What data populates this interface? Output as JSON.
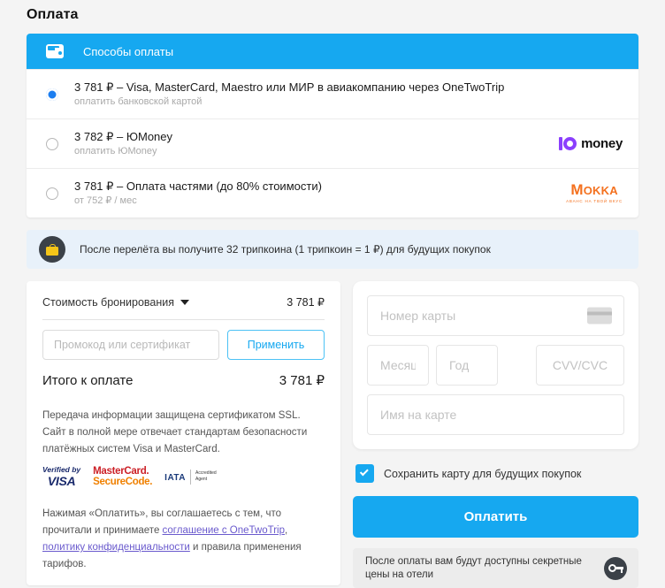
{
  "page": {
    "title": "Оплата"
  },
  "methods": {
    "header_title": "Способы оплаты",
    "header_icon": "wallet-icon",
    "options": [
      {
        "title": "3 781 ₽ – Visa, MasterCard, Maestro или МИР в авиакомпанию через OneTwoTrip",
        "subtitle": "оплатить банковской картой",
        "selected": true,
        "logo": null
      },
      {
        "title": "3 782 ₽ – ЮMoney",
        "subtitle": "оплатить ЮMoney",
        "selected": false,
        "logo": {
          "type": "yoomoney",
          "word": "money"
        }
      },
      {
        "title": "3 781 ₽ – Оплата частями (до 80% стоимости)",
        "subtitle": "от 752 ₽ / мес",
        "selected": false,
        "logo": {
          "type": "mokka",
          "word": "Mokka",
          "tagline": "АВАНС НА ТВОЙ ВКУС"
        }
      }
    ]
  },
  "tripcoin": {
    "icon": "shopping-bag-icon",
    "text": "После перелёта вы получите 32 трипкоина (1 трипкоин = 1 ₽) для будущих покупок"
  },
  "summary": {
    "cost_label": "Стоимость бронирования",
    "cost_chevron": "chevron-down-icon",
    "cost_value": "3 781 ₽",
    "promo_placeholder": "Промокод или сертификат",
    "promo_value": "",
    "apply_label": "Применить",
    "total_label": "Итого к оплате",
    "total_value": "3 781 ₽",
    "ssl_text": "Передача информации защищена сертификатом SSL. Сайт в полной мере отвечает стандартам безопасности платёжных систем Visa и MasterCard.",
    "badges": {
      "visa_line1": "Verified by",
      "visa_line2": "VISA",
      "mc_line1": "MasterCard.",
      "mc_line2": "SecureCode.",
      "iata_name": "IATA",
      "iata_acc1": "Accredited",
      "iata_acc2": "Agent"
    },
    "terms": {
      "part1": "Нажимая «Оплатить», вы соглашаетесь с тем, что прочитали и принимаете ",
      "link1": "соглашение с OneTwoTrip",
      "part2": ", ",
      "link2": "политику конфиденциальности",
      "part3": " и правила применения тарифов."
    }
  },
  "card_form": {
    "number_placeholder": "Номер карты",
    "number_value": "",
    "number_icon": "credit-card-icon",
    "month_placeholder": "Месяц",
    "month_value": "",
    "year_placeholder": "Год",
    "year_value": "",
    "cvv_placeholder": "CVV/CVC",
    "cvv_value": "",
    "name_placeholder": "Имя на карте",
    "name_value": "",
    "save_card_label": "Сохранить карту для будущих покупок",
    "save_card_checked": true,
    "pay_label": "Оплатить",
    "secret_line1": "После оплаты вам будут доступны секретные",
    "secret_line2": "цены на отели",
    "secret_icon": "key-icon"
  },
  "colors": {
    "accent_blue": "#16a8f0",
    "radio_blue": "#1c7ef0",
    "link_purple": "#6a5acd",
    "banner_bg": "#e8f1fa",
    "coin_yellow": "#f5c518",
    "mokka_orange": "#f4711f",
    "yoomoney_purple": "#8b3ffd"
  }
}
